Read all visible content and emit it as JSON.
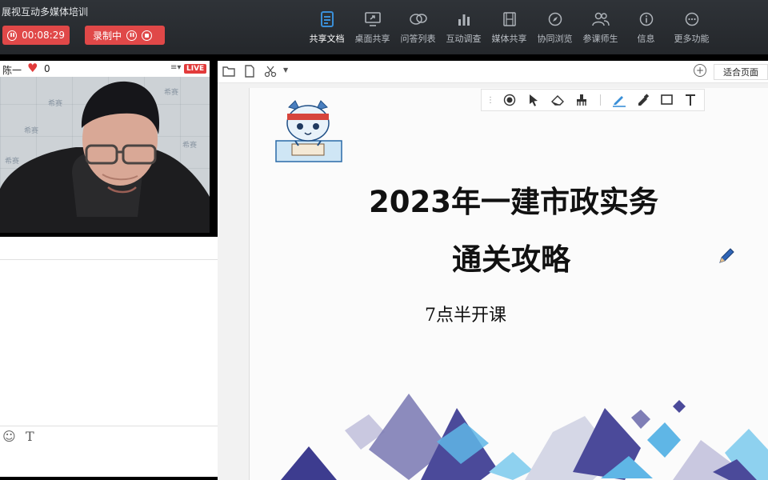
{
  "app": {
    "title": "展视互动多媒体培训"
  },
  "session": {
    "timer": "00:08:29",
    "record_label": "录制中"
  },
  "toolbar": {
    "items": [
      {
        "label": "共享文档",
        "icon": "document-icon",
        "active": true
      },
      {
        "label": "桌面共享",
        "icon": "desktop-share-icon",
        "active": false
      },
      {
        "label": "问答列表",
        "icon": "qa-icon",
        "active": false
      },
      {
        "label": "互动调查",
        "icon": "poll-chart-icon",
        "active": false
      },
      {
        "label": "媒体共享",
        "icon": "film-icon",
        "active": false
      },
      {
        "label": "协同浏览",
        "icon": "compass-icon",
        "active": false
      },
      {
        "label": "参课师生",
        "icon": "people-icon",
        "active": false
      },
      {
        "label": "信息",
        "icon": "info-icon",
        "active": false
      },
      {
        "label": "更多功能",
        "icon": "more-icon",
        "active": false
      }
    ]
  },
  "video": {
    "presenter": "陈一",
    "likes": "0",
    "live_badge": "LIVE",
    "watermark": "希赛"
  },
  "document": {
    "fit_label": "适合页面"
  },
  "slide": {
    "title": "2023年一建市政实务",
    "subtitle": "通关攻略",
    "note": "7点半开课"
  },
  "colors": {
    "accent": "#3a8fd8",
    "record": "#e04848",
    "toolbar_bg": "#2a2d31",
    "deco_purple": "#4b4a9a",
    "deco_blue": "#5fb6e6"
  }
}
